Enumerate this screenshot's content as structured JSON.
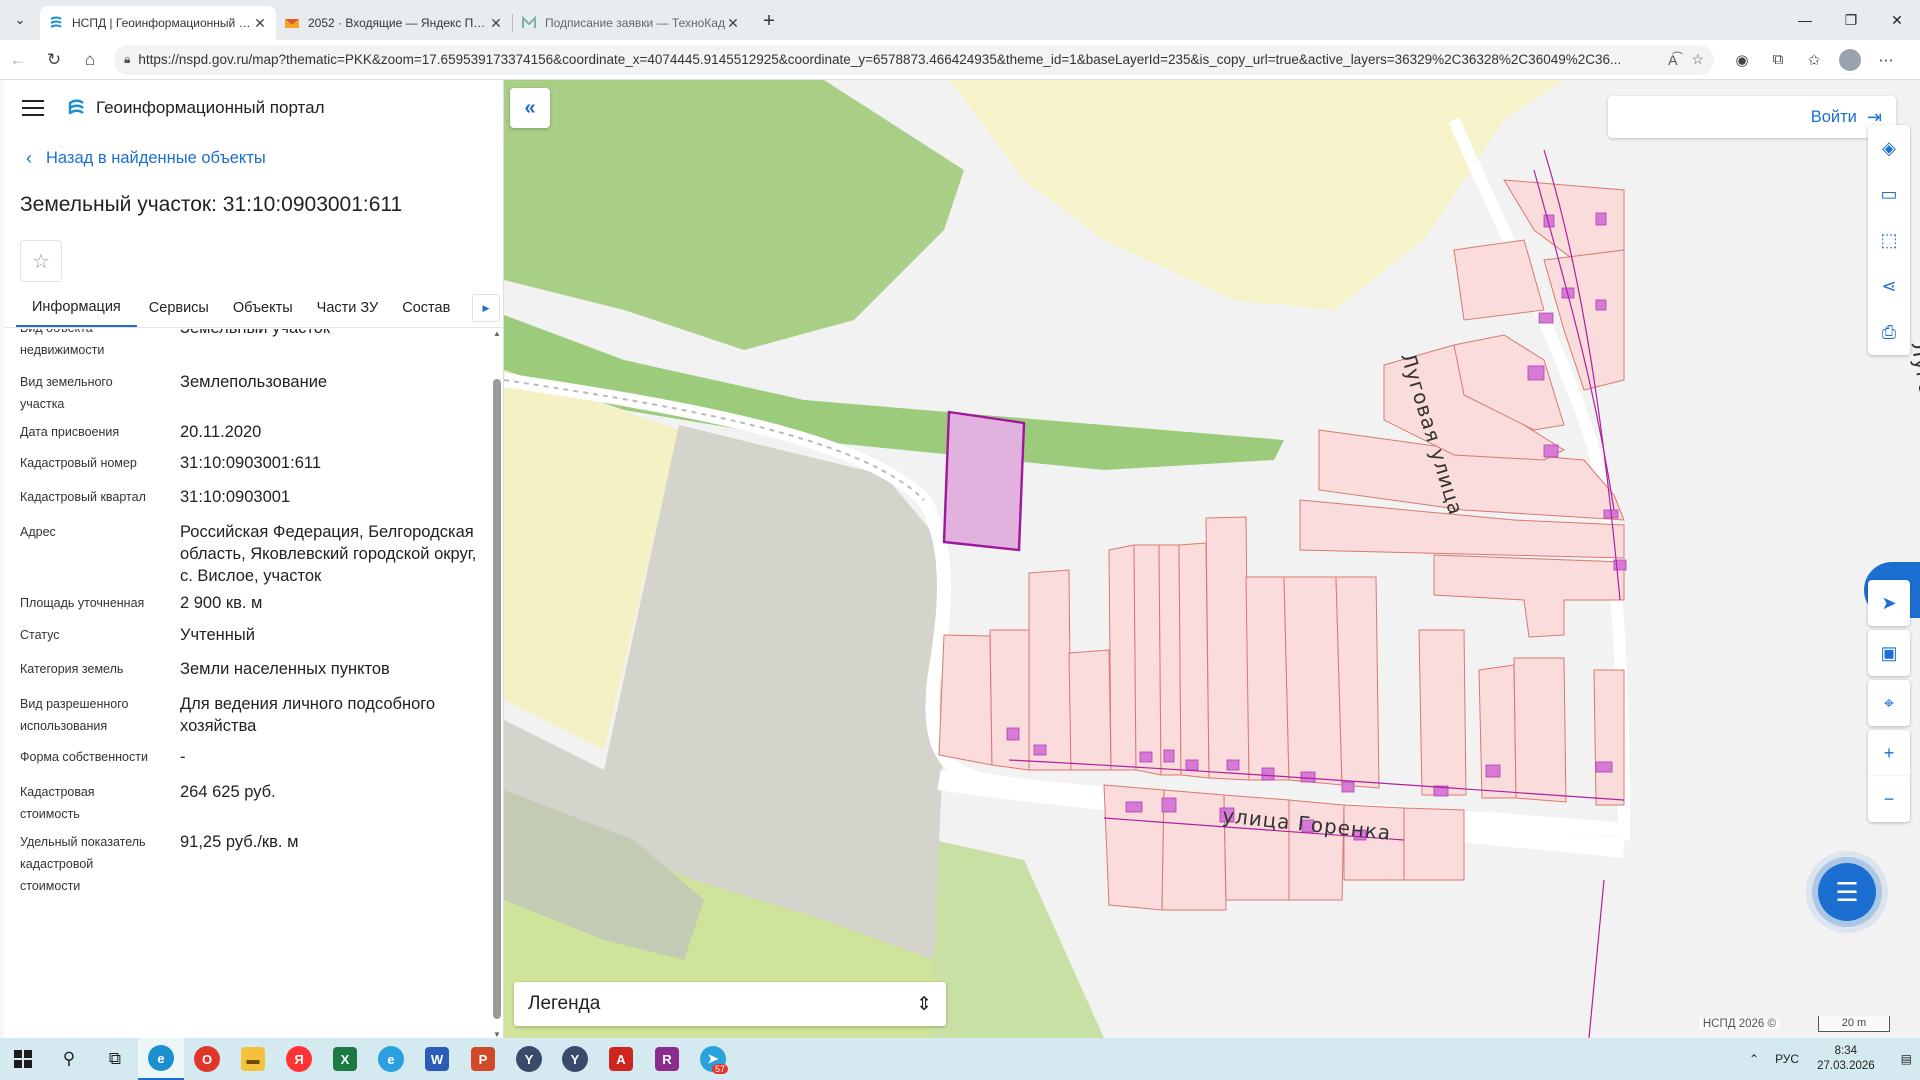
{
  "browser": {
    "tabs": [
      {
        "title": "НСПД | Геоинформационный портал",
        "active": true
      },
      {
        "title": "2052 · Входящие — Яндекс Почта",
        "active": false
      },
      {
        "title": "Подписание заявки — ТехноКад",
        "active": false
      }
    ],
    "url": "https://nspd.gov.ru/map?thematic=PKK&zoom=17.659539173374156&coordinate_x=4074445.9145512925&coordinate_y=6578873.466424935&theme_id=1&baseLayerId=235&is_copy_url=true&active_layers=36329%2C36328%2C36049%2C36..."
  },
  "sidebar": {
    "portal_title": "Геоинформационный портал",
    "back_label": "Назад в найденные объекты",
    "object_title": "Земельный участок: 31:10:0903001:611",
    "tabs": [
      "Информация",
      "Сервисы",
      "Объекты",
      "Части ЗУ",
      "Состав"
    ],
    "properties": [
      {
        "key": "Вид объекта недвижимости",
        "value": "Земельный участок"
      },
      {
        "key": "Вид земельного участка",
        "value": "Землепользование"
      },
      {
        "key": "Дата присвоения",
        "value": "20.11.2020"
      },
      {
        "key": "Кадастровый номер",
        "value": "31:10:0903001:611"
      },
      {
        "key": "Кадастровый квартал",
        "value": "31:10:0903001"
      },
      {
        "key": "Адрес",
        "value": "Российская Федерация, Белгородская область, Яковлевский городской округ, с. Вислое, участок"
      },
      {
        "key": "Площадь уточненная",
        "value": "2 900 кв. м"
      },
      {
        "key": "Статус",
        "value": "Учтенный"
      },
      {
        "key": "Категория земель",
        "value": "Земли населенных пунктов"
      },
      {
        "key": "Вид разрешенного использования",
        "value": "Для ведения личного подсобного хозяйства"
      },
      {
        "key": "Форма собственности",
        "value": "-"
      },
      {
        "key": "Кадастровая стоимость",
        "value": "264 625 руб."
      },
      {
        "key": "Удельный показатель кадастровой стоимости",
        "value": "91,25 руб./кв. м"
      }
    ]
  },
  "map": {
    "login_label": "Войти",
    "legend_label": "Легенда",
    "street_1": "улица Горенка",
    "street_2": "Луговая улица",
    "street_3": "Лугов",
    "copyright": "НСПД 2026 ©",
    "scale_label": "20 m",
    "colors": {
      "selected_parcel": "#e2b2df",
      "selected_border": "#a0179c",
      "parcel_fill": "#f9dcdb",
      "parcel_border": "#d9796f",
      "building": "#d77ad6",
      "field": "#a9cf87",
      "forest_grey": "#d4d4cc",
      "sand": "#f4f1c4",
      "accent": "#1c6fd1"
    }
  },
  "taskbar": {
    "time": "8:34",
    "date": "27.03.2026",
    "lang": "РУС",
    "telegram_badge": "57"
  }
}
